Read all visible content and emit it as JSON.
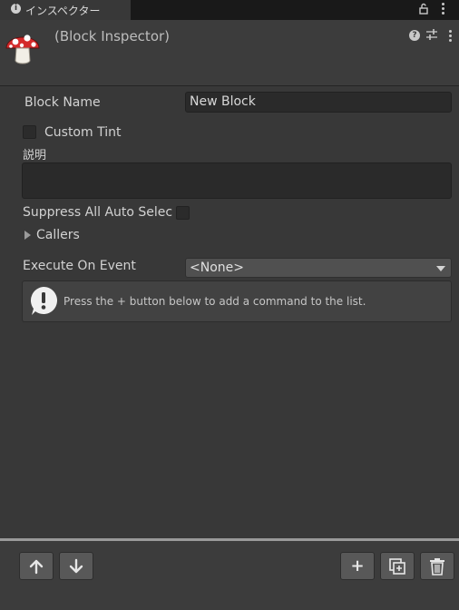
{
  "window": {
    "tab_title": "インスペクター",
    "tab_icon": "info-icon"
  },
  "header": {
    "title": "(Block Inspector)",
    "icon": "mushroom-icon"
  },
  "fields": {
    "block_name_label": "Block Name",
    "block_name_value": "New Block",
    "custom_tint_label": "Custom Tint",
    "custom_tint_checked": false,
    "description_label": "説明",
    "description_value": "",
    "suppress_label": "Suppress All Auto Selec",
    "suppress_checked": false,
    "callers_label": "Callers",
    "execute_label": "Execute On Event",
    "execute_value": "<None>"
  },
  "helpbox": {
    "text": "Press the + button below to add a command to the list.",
    "icon": "warning-icon"
  },
  "toolbar": {
    "buttons": [
      "move-up",
      "move-down",
      "add-command",
      "duplicate-command",
      "delete-command"
    ],
    "add_label": "+"
  },
  "colors": {
    "background": "#383838",
    "titlebar": "#191919",
    "field": "#2a2a2a",
    "button": "#585858"
  }
}
